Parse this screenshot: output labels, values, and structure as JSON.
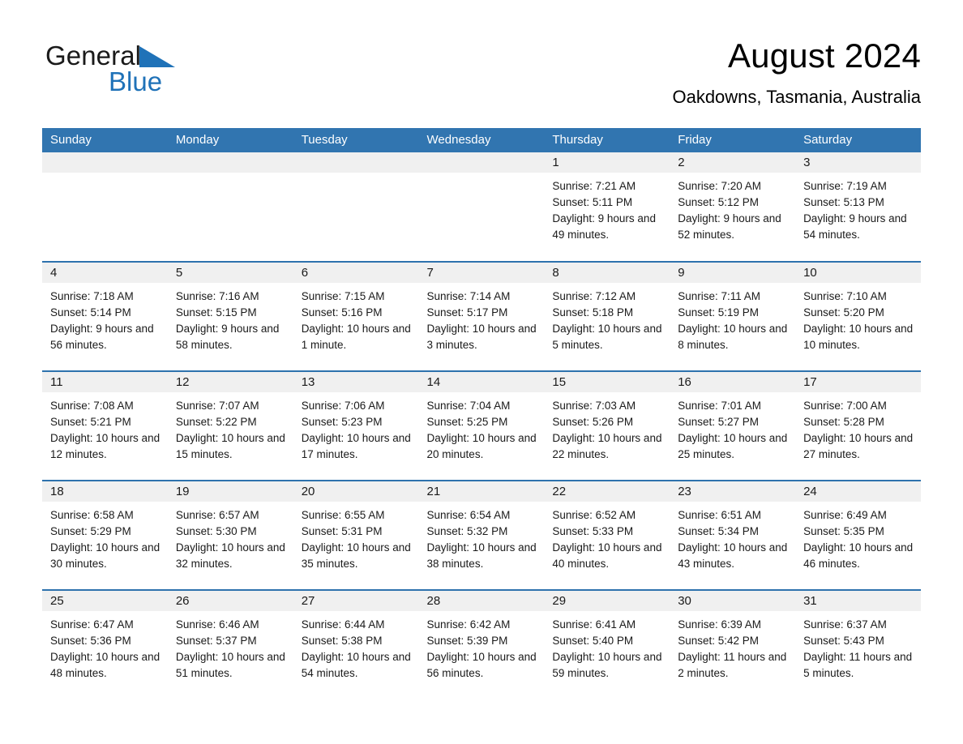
{
  "brand": {
    "name_part1": "General",
    "name_part2": "Blue",
    "triangle_color": "#1f72b8"
  },
  "header": {
    "title": "August 2024",
    "location": "Oakdowns, Tasmania, Australia"
  },
  "theme": {
    "header_blue": "#3175b0",
    "row_divider_blue": "#2e72ad",
    "daynum_band": "#f0f0f0",
    "text": "#1a1a1a"
  },
  "weekdays": [
    "Sunday",
    "Monday",
    "Tuesday",
    "Wednesday",
    "Thursday",
    "Friday",
    "Saturday"
  ],
  "labels": {
    "sunrise_prefix": "Sunrise:",
    "sunset_prefix": "Sunset:",
    "daylight_prefix": "Daylight:"
  },
  "weeks": [
    [
      {
        "day": "",
        "empty": true
      },
      {
        "day": "",
        "empty": true
      },
      {
        "day": "",
        "empty": true
      },
      {
        "day": "",
        "empty": true
      },
      {
        "day": "1",
        "sunrise": "Sunrise: 7:21 AM",
        "sunset": "Sunset: 5:11 PM",
        "daylight": "Daylight: 9 hours and 49 minutes."
      },
      {
        "day": "2",
        "sunrise": "Sunrise: 7:20 AM",
        "sunset": "Sunset: 5:12 PM",
        "daylight": "Daylight: 9 hours and 52 minutes."
      },
      {
        "day": "3",
        "sunrise": "Sunrise: 7:19 AM",
        "sunset": "Sunset: 5:13 PM",
        "daylight": "Daylight: 9 hours and 54 minutes."
      }
    ],
    [
      {
        "day": "4",
        "sunrise": "Sunrise: 7:18 AM",
        "sunset": "Sunset: 5:14 PM",
        "daylight": "Daylight: 9 hours and 56 minutes."
      },
      {
        "day": "5",
        "sunrise": "Sunrise: 7:16 AM",
        "sunset": "Sunset: 5:15 PM",
        "daylight": "Daylight: 9 hours and 58 minutes."
      },
      {
        "day": "6",
        "sunrise": "Sunrise: 7:15 AM",
        "sunset": "Sunset: 5:16 PM",
        "daylight": "Daylight: 10 hours and 1 minute."
      },
      {
        "day": "7",
        "sunrise": "Sunrise: 7:14 AM",
        "sunset": "Sunset: 5:17 PM",
        "daylight": "Daylight: 10 hours and 3 minutes."
      },
      {
        "day": "8",
        "sunrise": "Sunrise: 7:12 AM",
        "sunset": "Sunset: 5:18 PM",
        "daylight": "Daylight: 10 hours and 5 minutes."
      },
      {
        "day": "9",
        "sunrise": "Sunrise: 7:11 AM",
        "sunset": "Sunset: 5:19 PM",
        "daylight": "Daylight: 10 hours and 8 minutes."
      },
      {
        "day": "10",
        "sunrise": "Sunrise: 7:10 AM",
        "sunset": "Sunset: 5:20 PM",
        "daylight": "Daylight: 10 hours and 10 minutes."
      }
    ],
    [
      {
        "day": "11",
        "sunrise": "Sunrise: 7:08 AM",
        "sunset": "Sunset: 5:21 PM",
        "daylight": "Daylight: 10 hours and 12 minutes."
      },
      {
        "day": "12",
        "sunrise": "Sunrise: 7:07 AM",
        "sunset": "Sunset: 5:22 PM",
        "daylight": "Daylight: 10 hours and 15 minutes."
      },
      {
        "day": "13",
        "sunrise": "Sunrise: 7:06 AM",
        "sunset": "Sunset: 5:23 PM",
        "daylight": "Daylight: 10 hours and 17 minutes."
      },
      {
        "day": "14",
        "sunrise": "Sunrise: 7:04 AM",
        "sunset": "Sunset: 5:25 PM",
        "daylight": "Daylight: 10 hours and 20 minutes."
      },
      {
        "day": "15",
        "sunrise": "Sunrise: 7:03 AM",
        "sunset": "Sunset: 5:26 PM",
        "daylight": "Daylight: 10 hours and 22 minutes."
      },
      {
        "day": "16",
        "sunrise": "Sunrise: 7:01 AM",
        "sunset": "Sunset: 5:27 PM",
        "daylight": "Daylight: 10 hours and 25 minutes."
      },
      {
        "day": "17",
        "sunrise": "Sunrise: 7:00 AM",
        "sunset": "Sunset: 5:28 PM",
        "daylight": "Daylight: 10 hours and 27 minutes."
      }
    ],
    [
      {
        "day": "18",
        "sunrise": "Sunrise: 6:58 AM",
        "sunset": "Sunset: 5:29 PM",
        "daylight": "Daylight: 10 hours and 30 minutes."
      },
      {
        "day": "19",
        "sunrise": "Sunrise: 6:57 AM",
        "sunset": "Sunset: 5:30 PM",
        "daylight": "Daylight: 10 hours and 32 minutes."
      },
      {
        "day": "20",
        "sunrise": "Sunrise: 6:55 AM",
        "sunset": "Sunset: 5:31 PM",
        "daylight": "Daylight: 10 hours and 35 minutes."
      },
      {
        "day": "21",
        "sunrise": "Sunrise: 6:54 AM",
        "sunset": "Sunset: 5:32 PM",
        "daylight": "Daylight: 10 hours and 38 minutes."
      },
      {
        "day": "22",
        "sunrise": "Sunrise: 6:52 AM",
        "sunset": "Sunset: 5:33 PM",
        "daylight": "Daylight: 10 hours and 40 minutes."
      },
      {
        "day": "23",
        "sunrise": "Sunrise: 6:51 AM",
        "sunset": "Sunset: 5:34 PM",
        "daylight": "Daylight: 10 hours and 43 minutes."
      },
      {
        "day": "24",
        "sunrise": "Sunrise: 6:49 AM",
        "sunset": "Sunset: 5:35 PM",
        "daylight": "Daylight: 10 hours and 46 minutes."
      }
    ],
    [
      {
        "day": "25",
        "sunrise": "Sunrise: 6:47 AM",
        "sunset": "Sunset: 5:36 PM",
        "daylight": "Daylight: 10 hours and 48 minutes."
      },
      {
        "day": "26",
        "sunrise": "Sunrise: 6:46 AM",
        "sunset": "Sunset: 5:37 PM",
        "daylight": "Daylight: 10 hours and 51 minutes."
      },
      {
        "day": "27",
        "sunrise": "Sunrise: 6:44 AM",
        "sunset": "Sunset: 5:38 PM",
        "daylight": "Daylight: 10 hours and 54 minutes."
      },
      {
        "day": "28",
        "sunrise": "Sunrise: 6:42 AM",
        "sunset": "Sunset: 5:39 PM",
        "daylight": "Daylight: 10 hours and 56 minutes."
      },
      {
        "day": "29",
        "sunrise": "Sunrise: 6:41 AM",
        "sunset": "Sunset: 5:40 PM",
        "daylight": "Daylight: 10 hours and 59 minutes."
      },
      {
        "day": "30",
        "sunrise": "Sunrise: 6:39 AM",
        "sunset": "Sunset: 5:42 PM",
        "daylight": "Daylight: 11 hours and 2 minutes."
      },
      {
        "day": "31",
        "sunrise": "Sunrise: 6:37 AM",
        "sunset": "Sunset: 5:43 PM",
        "daylight": "Daylight: 11 hours and 5 minutes."
      }
    ]
  ]
}
